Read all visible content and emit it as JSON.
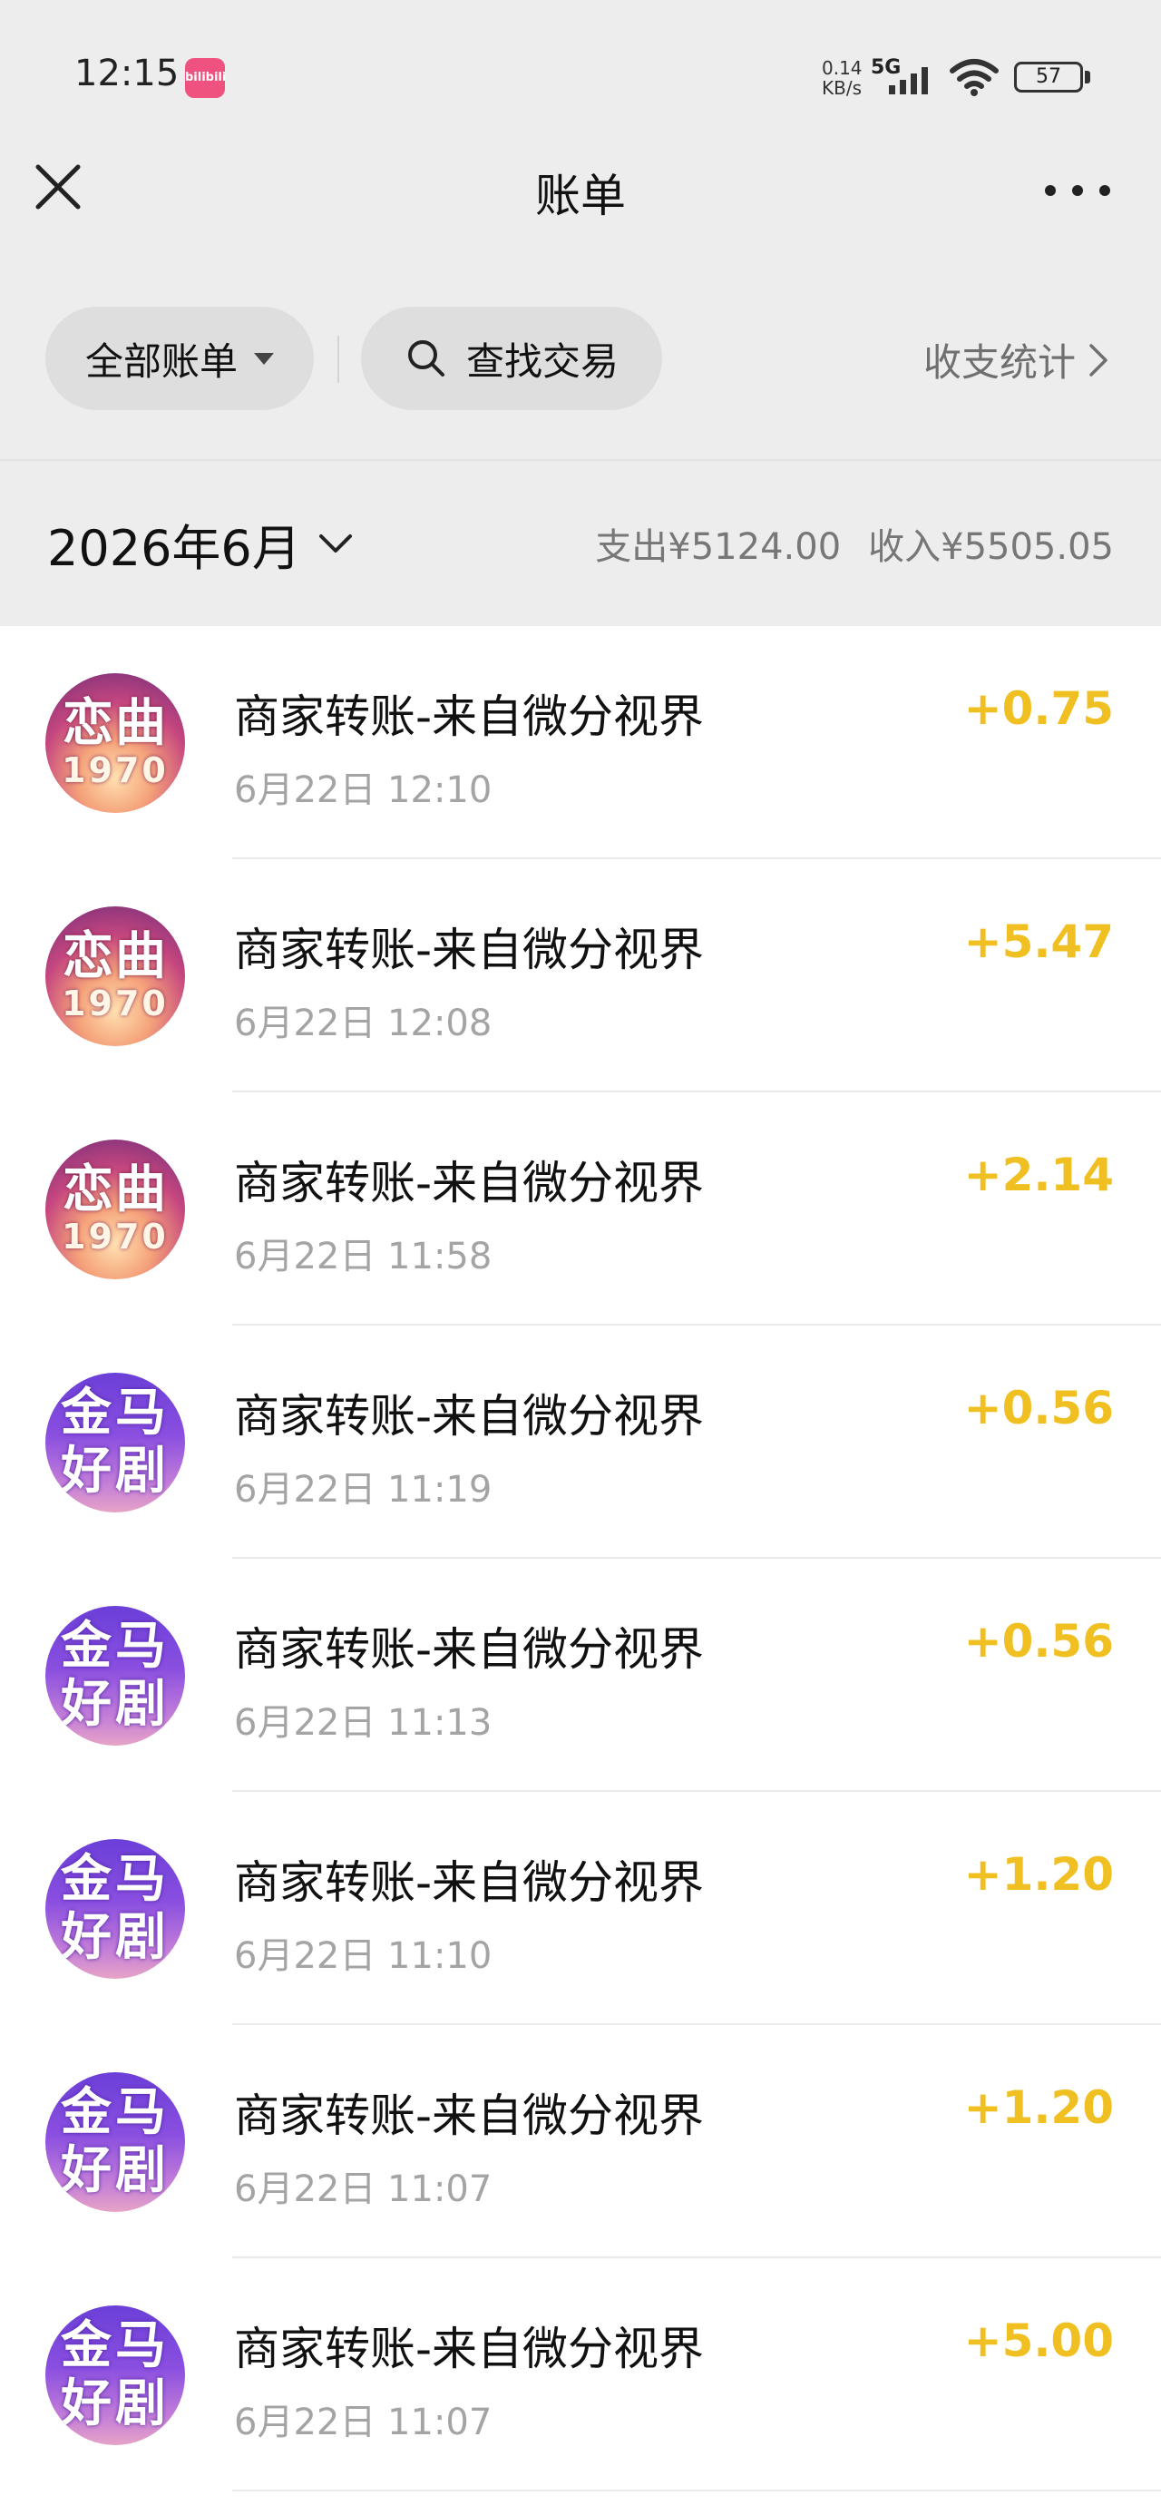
{
  "status_bar": {
    "time": "12:15",
    "app_icon_text": "bilibili",
    "speed": "0.14\nKB/s",
    "network": "5G",
    "battery": "57"
  },
  "header": {
    "title": "账单",
    "close_icon": "close-icon",
    "more_icon": "more-icon"
  },
  "filters": {
    "all_bills": "全部账单",
    "search": "查找交易",
    "stats": "收支统计"
  },
  "month": {
    "label": "2026年6月",
    "expense": "支出¥5124.00",
    "income": "收入¥5505.05"
  },
  "transactions": [
    {
      "avatar_line1": "恋曲",
      "avatar_line2": "1970",
      "title": "商家转账-来自微分视界",
      "time": "6月22日 12:10",
      "amount": "+0.75"
    },
    {
      "avatar_line1": "恋曲",
      "avatar_line2": "1970",
      "title": "商家转账-来自微分视界",
      "time": "6月22日 12:08",
      "amount": "+5.47"
    },
    {
      "avatar_line1": "恋曲",
      "avatar_line2": "1970",
      "title": "商家转账-来自微分视界",
      "time": "6月22日 11:58",
      "amount": "+2.14"
    },
    {
      "avatar_line1": "金马",
      "avatar_line2": "好剧",
      "title": "商家转账-来自微分视界",
      "time": "6月22日 11:19",
      "amount": "+0.56"
    },
    {
      "avatar_line1": "金马",
      "avatar_line2": "好剧",
      "title": "商家转账-来自微分视界",
      "time": "6月22日 11:13",
      "amount": "+0.56"
    },
    {
      "avatar_line1": "金马",
      "avatar_line2": "好剧",
      "title": "商家转账-来自微分视界",
      "time": "6月22日 11:10",
      "amount": "+1.20"
    },
    {
      "avatar_line1": "金马",
      "avatar_line2": "好剧",
      "title": "商家转账-来自微分视界",
      "time": "6月22日 11:07",
      "amount": "+1.20"
    },
    {
      "avatar_line1": "金马",
      "avatar_line2": "好剧",
      "title": "商家转账-来自微分视界",
      "time": "6月22日 11:07",
      "amount": "+5.00"
    }
  ],
  "colors": {
    "amount_income": "#f0c022",
    "background_gray": "#ededed"
  }
}
